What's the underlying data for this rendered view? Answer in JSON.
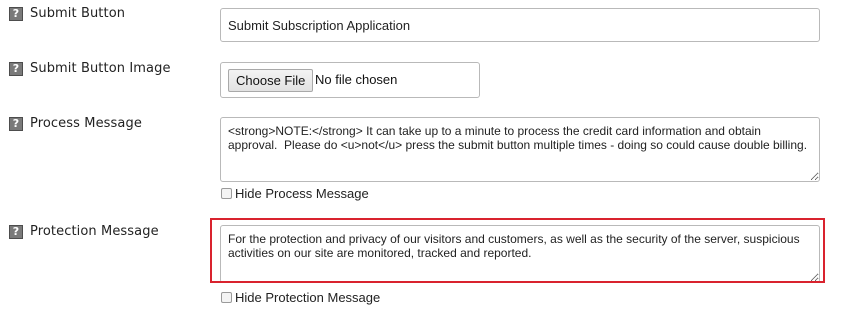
{
  "help_icon_glyph": "?",
  "submit_button": {
    "label": "Submit Button",
    "value": "Submit Subscription Application"
  },
  "submit_button_image": {
    "label": "Submit Button Image",
    "choose_file_label": "Choose File",
    "file_status": "No file chosen"
  },
  "process_message": {
    "label": "Process Message",
    "value": "<strong>NOTE:</strong> It can take up to a minute to process the credit card information and obtain approval.  Please do <u>not</u> press the submit button multiple times - doing so could cause double billing.",
    "hide_label": "Hide Process Message",
    "hide_checked": false
  },
  "protection_message": {
    "label": "Protection Message",
    "value": "For the protection and privacy of our visitors and customers, as well as the security of the server, suspicious activities on our site are monitored, tracked and reported.",
    "hide_label": "Hide Protection Message",
    "hide_checked": false
  },
  "colors": {
    "highlight": "#d9232e",
    "help_icon_bg": "#7a7a7a",
    "input_border": "#b9b9b9"
  }
}
